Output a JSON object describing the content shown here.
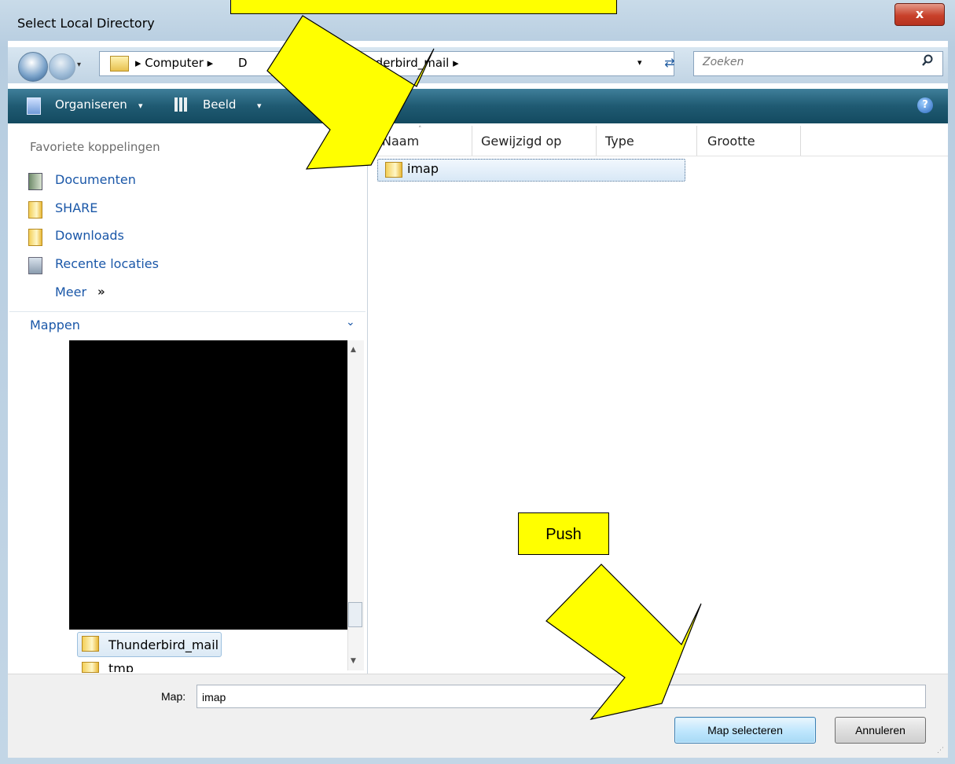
{
  "window": {
    "title": "Select Local Directory",
    "close_glyph": "x"
  },
  "nav": {
    "back_glyph": "←",
    "forward_glyph": "→",
    "dropdown_glyph": "▾"
  },
  "address": {
    "crumbs": [
      "▸ Computer ▸",
      "D",
      "Thunderbird_mail ▸"
    ],
    "dropdown_glyph": "▾",
    "refresh_glyph": "⇄"
  },
  "search": {
    "placeholder": "Zoeken",
    "icon": "search-icon"
  },
  "toolbar": {
    "organize_label": "Organiseren",
    "view_label": "Beeld",
    "dropdown_glyph": "▾",
    "help_glyph": "?"
  },
  "sidebar": {
    "header": "Favoriete koppelingen",
    "items": [
      {
        "label": "Documenten",
        "icon": "documents-icon"
      },
      {
        "label": "SHARE",
        "icon": "folder-icon"
      },
      {
        "label": "Downloads",
        "icon": "folder-icon"
      },
      {
        "label": "Recente locaties",
        "icon": "recent-locations-icon"
      }
    ],
    "more_label": "Meer",
    "more_glyph": "»",
    "folders_label": "Mappen",
    "folders_chevron": "⌄"
  },
  "tree": {
    "items": [
      {
        "label": "Thunderbird_mail",
        "selected": true
      },
      {
        "label": "tmp"
      }
    ],
    "scroll_up": "▲",
    "scroll_down": "▼"
  },
  "list": {
    "columns": [
      "Naam",
      "Gewijzigd op",
      "Type",
      "Grootte"
    ],
    "sort_glyph": "˄",
    "rows": [
      {
        "name": "imap"
      }
    ]
  },
  "footer": {
    "folder_label": "Map:",
    "folder_value": "imap",
    "select_button": "Map selecteren",
    "cancel_button": "Annuleren",
    "grip_glyph": "⋰"
  },
  "annotations": {
    "push_label": "Push",
    "color": "#ffff00"
  }
}
